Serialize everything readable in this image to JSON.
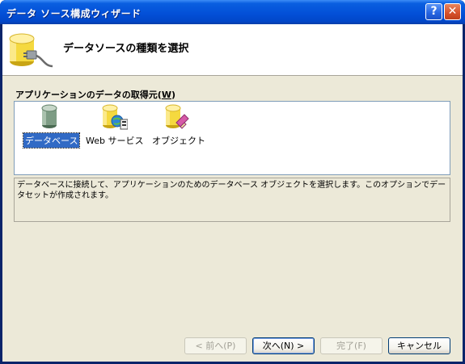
{
  "window": {
    "title": "データ ソース構成ウィザード",
    "help_glyph": "?",
    "close_glyph": "✕"
  },
  "header": {
    "title": "データソースの種類を選択",
    "icon": "database-plug-icon"
  },
  "source_section": {
    "label": "アプリケーションのデータの取得元(",
    "mnemonic": "W",
    "label_end": ")"
  },
  "types": [
    {
      "label": "データベース",
      "icon": "database-icon",
      "selected": true
    },
    {
      "label": "Web サービス",
      "icon": "web-service-icon",
      "selected": false
    },
    {
      "label": "オブジェクト",
      "icon": "object-icon",
      "selected": false
    }
  ],
  "description": "データベースに接続して、アプリケーションのためのデータベース オブジェクトを選択します。このオプションでデータセットが作成されます。",
  "buttons": {
    "back": "< 前へ(P)",
    "next": "次へ(N) >",
    "finish": "完了(F)",
    "cancel": "キャンセル"
  },
  "colors": {
    "titlebar": "#0350d8",
    "selection": "#316ac5",
    "dialog_bg": "#ece9d8"
  }
}
